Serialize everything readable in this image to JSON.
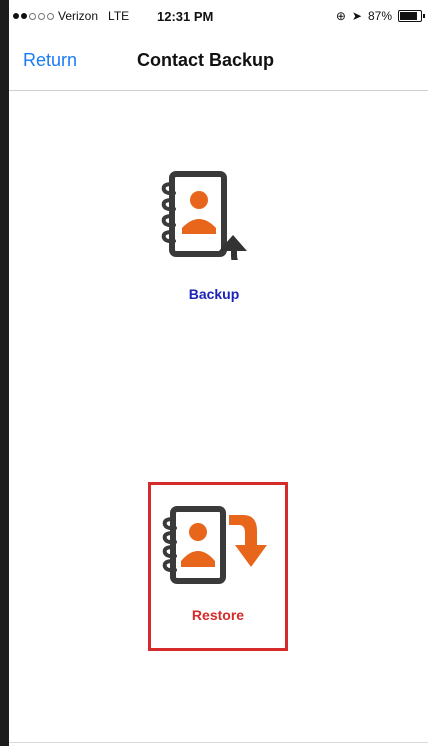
{
  "status": {
    "carrier": "Verizon",
    "network": "LTE",
    "time": "12:31 PM",
    "battery": "87%",
    "signal_full_dots": 2,
    "signal_total_dots": 5,
    "battery_level": 0.87
  },
  "nav": {
    "back_label": "Return",
    "title": "Contact Backup"
  },
  "actions": {
    "backup_label": "Backup",
    "restore_label": "Restore"
  },
  "colors": {
    "accent_blue": "#1a7cf5",
    "backup_label": "#1e23b8",
    "restore": "#d62b2b",
    "person": "#e8651c",
    "book": "#3a3a3a"
  },
  "icons": {
    "backup": "contact-book-up-arrow-icon",
    "restore": "contact-book-down-arrow-icon"
  }
}
